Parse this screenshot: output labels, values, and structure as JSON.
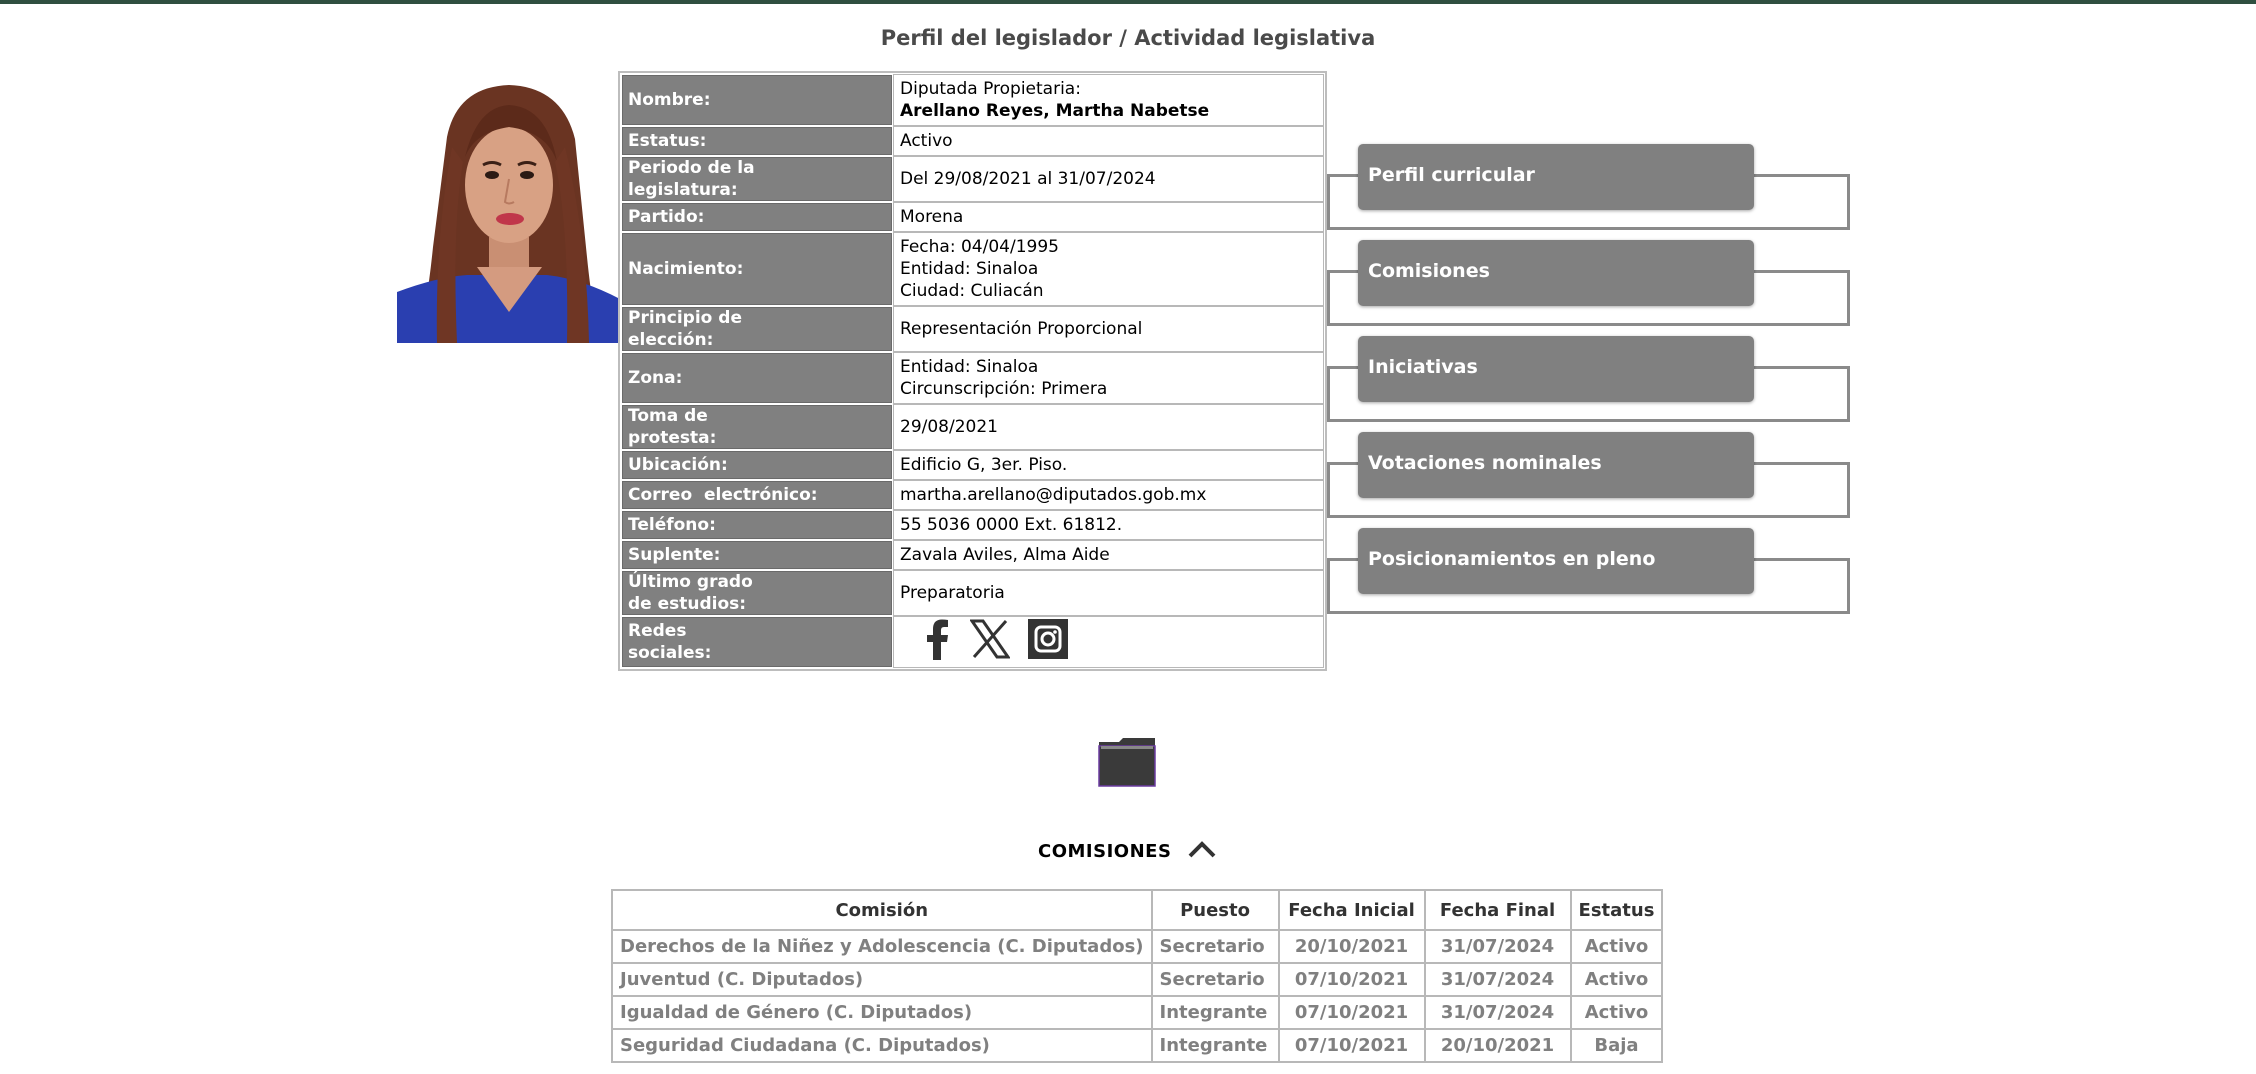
{
  "page": {
    "title": "Perfil del legislador / Actividad legislativa"
  },
  "profile": {
    "rows": [
      {
        "label": "Nombre:",
        "value_line1": "Diputada Propietaria:",
        "value_line2": "Arellano Reyes, Martha Nabetse"
      },
      {
        "label": "Estatus:",
        "value": "Activo"
      },
      {
        "label_line1": "Periodo de la",
        "label_line2": "legislatura:",
        "value": "Del 29/08/2021 al 31/07/2024"
      },
      {
        "label": "Partido:",
        "value": "Morena"
      },
      {
        "label": "Nacimiento:",
        "value_line1": "Fecha: 04/04/1995",
        "value_line2": "Entidad: Sinaloa",
        "value_line3": "Ciudad: Culiacán"
      },
      {
        "label_line1": "Principio de",
        "label_line2": "elección:",
        "value": "Representación Proporcional"
      },
      {
        "label": "Zona:",
        "value_line1": "Entidad: Sinaloa",
        "value_line2": "Circunscripción: Primera"
      },
      {
        "label_line1": "Toma de",
        "label_line2": "protesta:",
        "value": "29/08/2021"
      },
      {
        "label": "Ubicación:",
        "value": "Edificio G, 3er. Piso."
      },
      {
        "label": "Correo  electrónico:",
        "value": "martha.arellano@diputados.gob.mx"
      },
      {
        "label": "Teléfono:",
        "value": "55 5036 0000 Ext. 61812."
      },
      {
        "label": "Suplente:",
        "value": "Zavala Aviles, Alma Aide"
      },
      {
        "label_line1": "Último grado",
        "label_line2": "de estudios:",
        "value": "Preparatoria"
      },
      {
        "label_line1": "Redes",
        "label_line2": "sociales:"
      }
    ],
    "social_icons": [
      "facebook-icon",
      "x-icon",
      "instagram-icon"
    ]
  },
  "side_menu": {
    "items": [
      "Perfil curricular",
      "Comisiones",
      "Iniciativas",
      "Votaciones nominales",
      "Posicionamientos en pleno"
    ]
  },
  "comisiones": {
    "heading": "COMISIONES",
    "columns": [
      "Comisión",
      "Puesto",
      "Fecha Inicial",
      "Fecha Final",
      "Estatus"
    ],
    "rows": [
      [
        "Derechos de la Niñez y Adolescencia (C. Diputados)",
        "Secretario",
        "20/10/2021",
        "31/07/2024",
        "Activo"
      ],
      [
        "Juventud (C. Diputados)",
        "Secretario",
        "07/10/2021",
        "31/07/2024",
        "Activo"
      ],
      [
        "Igualdad de Género (C. Diputados)",
        "Integrante",
        "07/10/2021",
        "31/07/2024",
        "Activo"
      ],
      [
        "Seguridad Ciudadana (C. Diputados)",
        "Integrante",
        "07/10/2021",
        "20/10/2021",
        "Baja"
      ]
    ]
  },
  "colors": {
    "label_bg": "#808080",
    "topbar": "#2f4f40",
    "row_text": "#808080"
  }
}
